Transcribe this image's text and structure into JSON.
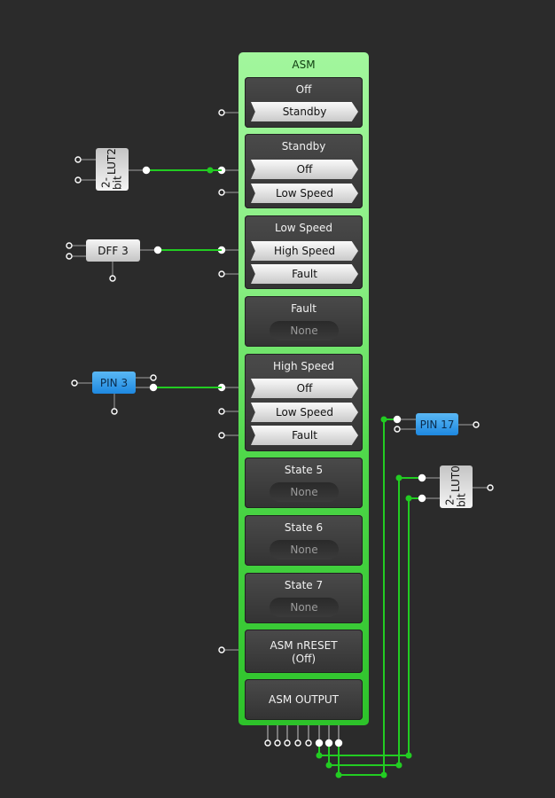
{
  "asm": {
    "title": "ASM",
    "states": [
      {
        "name": "Off",
        "transitions": [
          "Standby"
        ]
      },
      {
        "name": "Standby",
        "transitions": [
          "Off",
          "Low Speed"
        ]
      },
      {
        "name": "Low Speed",
        "transitions": [
          "High Speed",
          "Fault"
        ]
      },
      {
        "name": "Fault",
        "transitions": [],
        "empty_label": "None"
      },
      {
        "name": "High Speed",
        "transitions": [
          "Off",
          "Low Speed",
          "Fault"
        ]
      },
      {
        "name": "State 5",
        "transitions": [],
        "empty_label": "None"
      },
      {
        "name": "State 6",
        "transitions": [],
        "empty_label": "None"
      },
      {
        "name": "State 7",
        "transitions": [],
        "empty_label": "None"
      }
    ],
    "nreset_label": "ASM nRESET",
    "nreset_value": "(Off)",
    "output_label": "ASM OUTPUT"
  },
  "blocks": {
    "lut2": {
      "line1": "2-bit",
      "line2": "LUT2"
    },
    "dff3": {
      "label": "DFF 3"
    },
    "pin3": {
      "label": "PIN 3"
    },
    "pin17": {
      "label": "PIN 17"
    },
    "lut0": {
      "line1": "2-bit",
      "line2": "LUT0"
    }
  },
  "colors": {
    "wire_active": "#22cc22",
    "wire_inactive": "#8a8a8a",
    "pin_blue": "#2a90e6"
  }
}
